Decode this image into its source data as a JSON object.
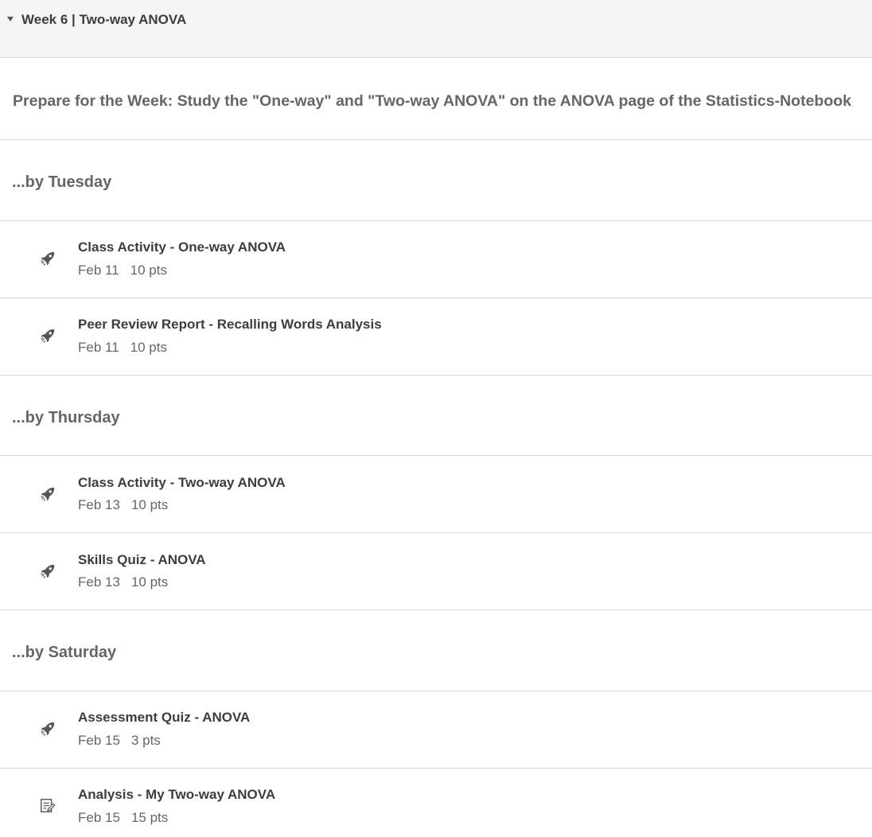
{
  "module": {
    "title": "Week 6 | Two-way ANOVA",
    "caret_icon": "caret-down-icon"
  },
  "intro": {
    "text": "Prepare for the Week: Study the \"One-way\" and \"Two-way ANOVA\" on the ANOVA page of the Statistics-Notebook"
  },
  "sections": [
    {
      "heading": "...by Tuesday",
      "items": [
        {
          "title": "Class Activity - One-way ANOVA",
          "date": "Feb 11",
          "points": "10 pts",
          "icon": "rocket-icon"
        },
        {
          "title": "Peer Review Report - Recalling Words Analysis",
          "date": "Feb 11",
          "points": "10 pts",
          "icon": "rocket-icon"
        }
      ]
    },
    {
      "heading": "...by Thursday",
      "items": [
        {
          "title": "Class Activity - Two-way ANOVA",
          "date": "Feb 13",
          "points": "10 pts",
          "icon": "rocket-icon"
        },
        {
          "title": "Skills Quiz - ANOVA",
          "date": "Feb 13",
          "points": "10 pts",
          "icon": "rocket-icon"
        }
      ]
    },
    {
      "heading": "...by Saturday",
      "items": [
        {
          "title": "Assessment Quiz - ANOVA",
          "date": "Feb 15",
          "points": "3 pts",
          "icon": "rocket-icon"
        },
        {
          "title": "Analysis - My Two-way ANOVA",
          "date": "Feb 15",
          "points": "15 pts",
          "icon": "assignment-icon"
        }
      ]
    }
  ]
}
